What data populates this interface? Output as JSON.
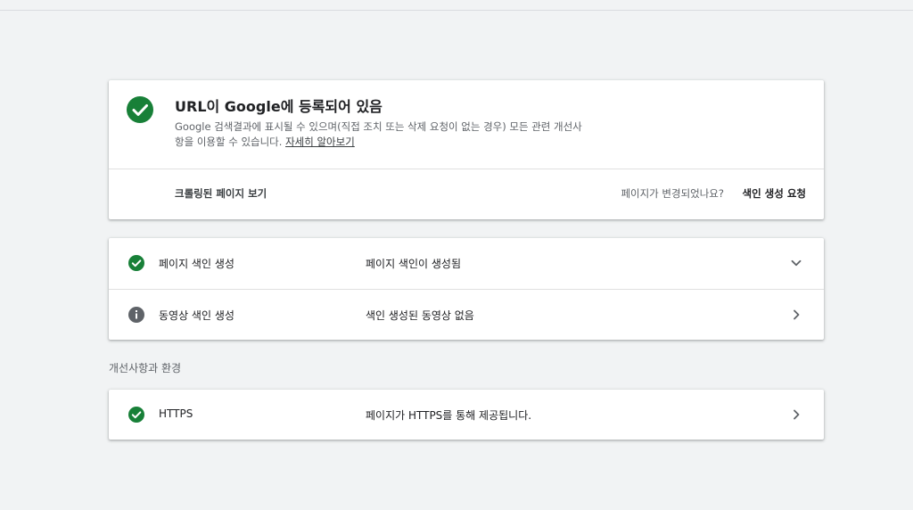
{
  "colors": {
    "success_green": "#188038",
    "info_gray": "#5f6368",
    "background": "#f1f3f4"
  },
  "main_card": {
    "icon": "check-circle-icon",
    "title": "URL이 Google에 등록되어 있음",
    "description_line1": "Google 검색결과에 표시될 수 있으며(직접 조치 또는 삭제 요청이 없는 경우) 모든 관련 개선사",
    "description_line2": "항을 이용할 수 있습니다. ",
    "learn_more": "자세히 알아보기",
    "view_crawled": "크롤링된 페이지 보기",
    "page_changed_question": "페이지가 변경되었나요?",
    "request_indexing": "색인 생성 요청"
  },
  "coverage": [
    {
      "icon": "check-circle-icon",
      "label": "페이지 색인 생성",
      "value": "페이지 색인이 생성됨",
      "chevron": "chevron-down-icon"
    },
    {
      "icon": "info-icon",
      "label": "동영상 색인 생성",
      "value": "색인 생성된 동영상 없음",
      "chevron": "chevron-right-icon"
    }
  ],
  "enhancements_heading": "개선사항과 환경",
  "enhancements": [
    {
      "icon": "check-circle-icon",
      "label": "HTTPS",
      "value": "페이지가 HTTPS를 통해 제공됩니다.",
      "chevron": "chevron-right-icon"
    }
  ]
}
